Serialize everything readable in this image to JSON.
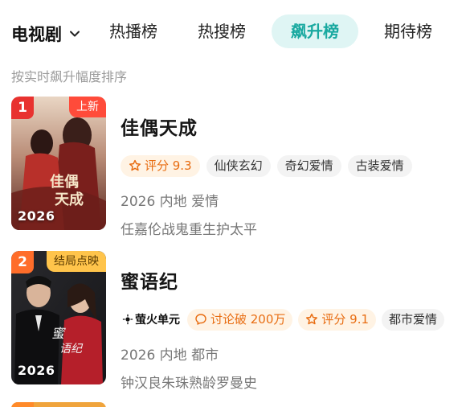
{
  "header": {
    "category_selector": "电视剧",
    "tabs": [
      {
        "label": "热播榜",
        "active": false
      },
      {
        "label": "热搜榜",
        "active": false
      },
      {
        "label": "飙升榜",
        "active": true
      },
      {
        "label": "期待榜",
        "active": false
      }
    ],
    "accent_color": "#19a9a0"
  },
  "sort_hint": "按实时飙升幅度排序",
  "items": [
    {
      "rank": "1",
      "badge": "上新",
      "year": "2026",
      "title": "佳偶天成",
      "score_label": "评分 9.3",
      "tags": [
        "仙侠玄幻",
        "奇幻爱情",
        "古装爱情"
      ],
      "meta": "2026 内地 爱情",
      "cast": "任嘉伦战鬼重生护太平",
      "poster_text": "佳偶天成"
    },
    {
      "rank": "2",
      "badge": "结局点映",
      "year": "2026",
      "title": "蜜语纪",
      "platform": "萤火单元",
      "discussion_label": "讨论破 200万",
      "score_label": "评分 9.1",
      "tags": [
        "都市爱情"
      ],
      "meta": "2026 内地 都市",
      "cast": "钟汉良朱珠熟龄罗曼史",
      "poster_text": "蜜语纪"
    }
  ]
}
